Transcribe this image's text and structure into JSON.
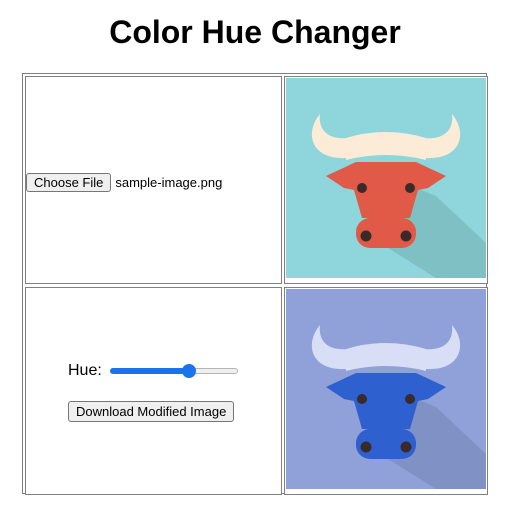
{
  "page": {
    "title": "Color Hue Changer"
  },
  "upload": {
    "button_label": "Choose File",
    "file_name": "sample-image.png"
  },
  "controls": {
    "hue_label": "Hue:",
    "hue_slider_fraction": 0.62,
    "download_label": "Download Modified Image"
  },
  "images": {
    "original": {
      "subject": "bull head icon",
      "background": "#8ed6dc",
      "head": "#e05a47",
      "horns": "#fbebd7",
      "shadow": "#7fc0c5"
    },
    "modified": {
      "subject": "bull head icon",
      "background": "#8fa1d8",
      "head": "#2f60cf",
      "horns": "#d7def5",
      "shadow": "#8091c5"
    }
  },
  "colors": {
    "slider_accent": "#1a73e8"
  }
}
